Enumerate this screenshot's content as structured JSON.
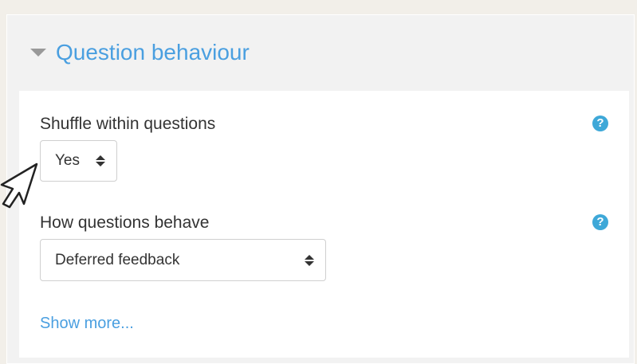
{
  "section": {
    "title": "Question behaviour"
  },
  "fields": {
    "shuffle": {
      "label": "Shuffle within questions",
      "value": "Yes"
    },
    "behave": {
      "label": "How questions behave",
      "value": "Deferred feedback"
    }
  },
  "help_icon_glyph": "?",
  "show_more": "Show more...",
  "colors": {
    "accent": "#4a9fe0",
    "help": "#3ea8d8",
    "panel": "#f2f2f2",
    "page": "#f2efe9"
  },
  "icons": {
    "collapse": "caret-down-icon",
    "help": "question-circle-icon",
    "select_arrows": "sort-icon",
    "cursor": "pointer-arrow-icon"
  }
}
